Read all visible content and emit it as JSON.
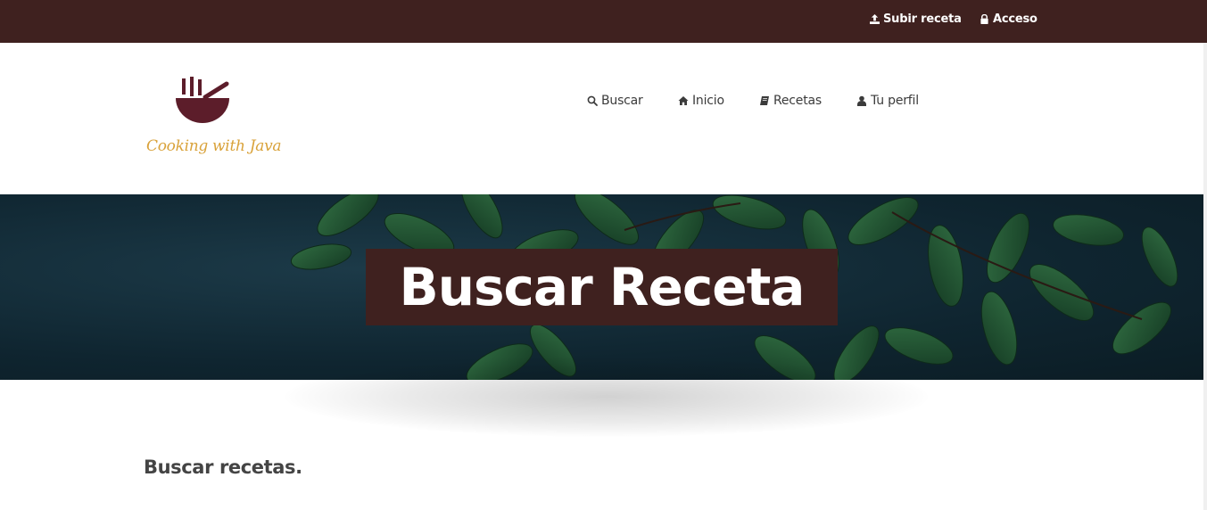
{
  "topbar": {
    "upload": {
      "label": "Subir receta",
      "icon": "upload-icon"
    },
    "login": {
      "label": "Acceso",
      "icon": "lock-icon"
    }
  },
  "logo": {
    "text": "Cooking with Java"
  },
  "nav": [
    {
      "label": "Buscar",
      "icon": "search-icon"
    },
    {
      "label": "Inicio",
      "icon": "home-icon"
    },
    {
      "label": "Recetas",
      "icon": "book-icon"
    },
    {
      "label": "Tu perfil",
      "icon": "user-icon"
    }
  ],
  "hero": {
    "title": "Buscar Receta"
  },
  "main": {
    "section_title": "Buscar recetas."
  },
  "colors": {
    "topbar": "#3f211f",
    "hero_title_bg": "#3f211f",
    "logo_bowl": "#5c1d2a",
    "logo_text": "#d9a23a"
  }
}
